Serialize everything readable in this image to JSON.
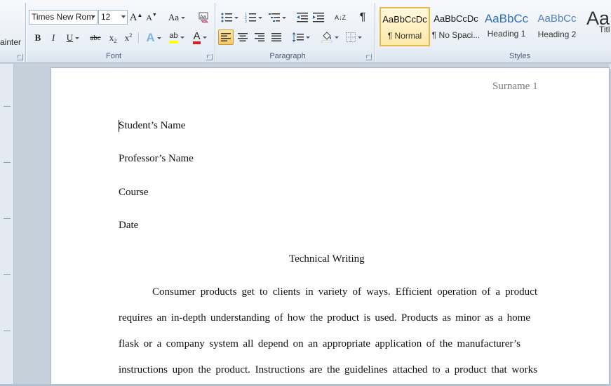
{
  "ribbon": {
    "clipboard_partial_label": "ainter",
    "font": {
      "name": "Times New Rom",
      "size": "12",
      "grow_label": "A",
      "shrink_label": "A",
      "change_case_label": "Aa",
      "bold": "B",
      "italic": "I",
      "underline": "U",
      "strikethrough": "abc",
      "subscript": "x",
      "superscript": "x",
      "text_effects": "A",
      "highlight": "ab",
      "font_color": "A",
      "highlight_color": "#ffff00",
      "font_color_bar": "#e01b1b",
      "group_label": "Font"
    },
    "paragraph": {
      "group_label": "Paragraph",
      "pilcrow": "¶",
      "sort": "A↓Z"
    },
    "styles": {
      "group_label": "Styles",
      "items": [
        {
          "preview": "AaBbCcDc",
          "name": "¶ Normal"
        },
        {
          "preview": "AaBbCcDc",
          "name": "¶ No Spaci..."
        },
        {
          "preview": "AaBbCc",
          "name": "Heading 1"
        },
        {
          "preview": "AaBbCc",
          "name": "Heading 2"
        },
        {
          "preview": "Aa",
          "name": "Title"
        }
      ],
      "heading_color": "#2f6eba",
      "heading2_color": "#4f81bd"
    }
  },
  "document": {
    "header": "Surname 1",
    "lines": [
      "Student’s Name",
      "Professor’s Name",
      "Course",
      "Date"
    ],
    "title": "Technical Writing",
    "body": [
      "Consumer products get to clients in variety of ways. Efficient operation of a product",
      "requires an in-depth understanding of how the product is used. Products as minor as a home",
      "flask or a company system all depend on an appropriate application of the manufacturer’s",
      "instructions upon the product. Instructions are the guidelines attached to a product that works"
    ]
  }
}
